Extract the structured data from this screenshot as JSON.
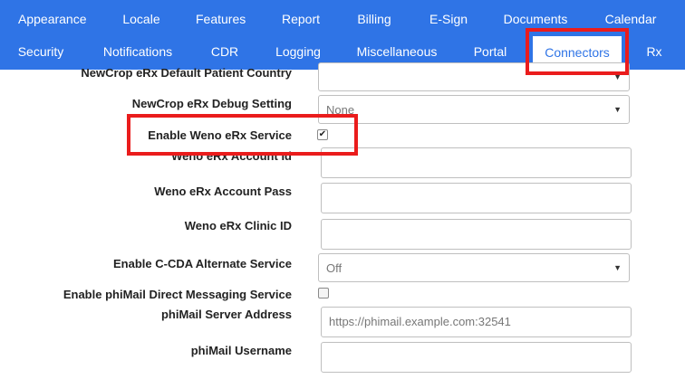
{
  "nav": {
    "row1": [
      "Appearance",
      "Locale",
      "Features",
      "Report",
      "Billing",
      "E-Sign",
      "Documents",
      "Calendar"
    ],
    "row2": [
      "Security",
      "Notifications",
      "CDR",
      "Logging",
      "Miscellaneous",
      "Portal",
      "Connectors",
      "Rx"
    ],
    "active": "Connectors"
  },
  "form": {
    "newcrop_country_label": "NewCrop eRx Default Patient Country",
    "newcrop_debug_label": "NewCrop eRx Debug Setting",
    "newcrop_debug_value": "None",
    "weno_enable_label": "Enable Weno eRx Service",
    "weno_account_id_label": "Weno eRx Account Id",
    "weno_account_pass_label": "Weno eRx Account Pass",
    "weno_clinic_id_label": "Weno eRx Clinic ID",
    "ccda_label": "Enable C-CDA Alternate Service",
    "ccda_value": "Off",
    "phimail_enable_label": "Enable phiMail Direct Messaging Service",
    "phimail_server_label": "phiMail Server Address",
    "phimail_server_placeholder": "https://phimail.example.com:32541",
    "phimail_username_label": "phiMail Username"
  },
  "colors": {
    "nav_bg": "#2f74e6",
    "active_tab_text": "#2f74e6",
    "highlight": "#ea1c1c"
  }
}
